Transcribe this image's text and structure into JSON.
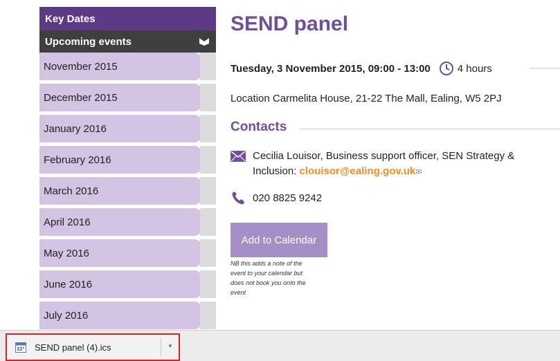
{
  "sidebar": {
    "heading": "Key Dates",
    "section": "Upcoming events",
    "months": [
      "November 2015",
      "December 2015",
      "January 2016",
      "February 2016",
      "March 2016",
      "April 2016",
      "May 2016",
      "June 2016",
      "July 2016"
    ]
  },
  "event": {
    "title": "SEND panel",
    "date": "Tuesday, 3 November 2015, 09:00 - 13:00",
    "duration": "4 hours",
    "location": "Location Carmelita House, 21-22 The Mall, Ealing, W5 2PJ"
  },
  "contacts": {
    "heading": "Contacts",
    "person": "Cecilia Louisor, Business support officer, SEN Strategy & Inclusion: ",
    "email": "clouisor@ealing.gov.uk",
    "phone": "020 8825 9242"
  },
  "calendar": {
    "button_label": "Add to Calendar",
    "note": "NB this adds a note of the event to your calendar but does not book you onto the event"
  },
  "download": {
    "filename": "SEND panel (4).ics"
  },
  "colors": {
    "brand_purple": "#6e4ea0",
    "sidebar_header": "#5b3a86",
    "month_bg": "#d3c4e3",
    "button_bg": "#a58fc6",
    "email_orange": "#f0901e",
    "highlight_red": "#e02020"
  }
}
